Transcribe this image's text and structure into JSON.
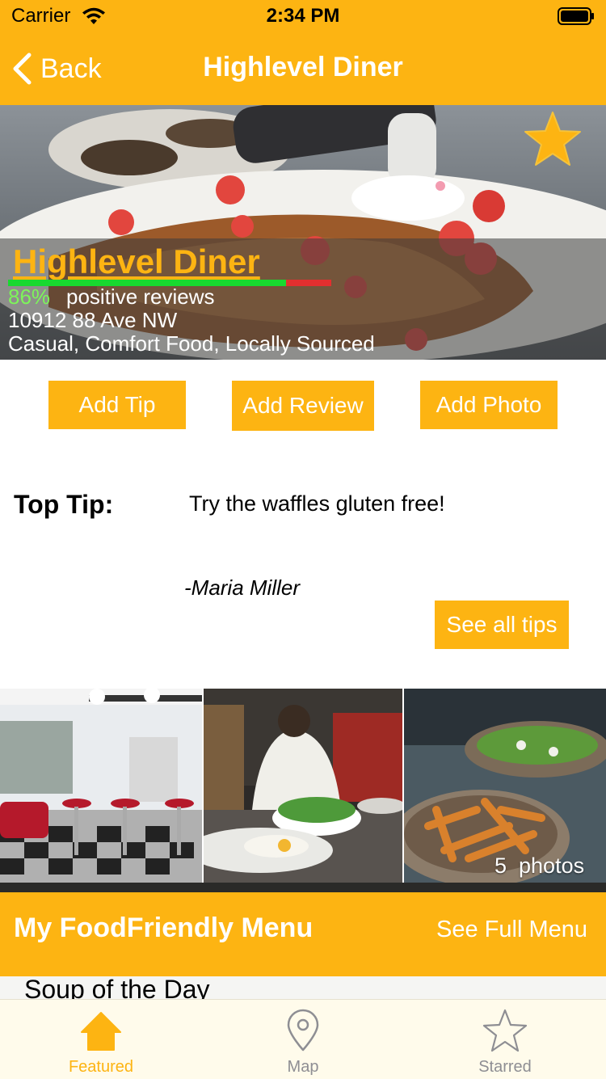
{
  "status_bar": {
    "carrier": "Carrier",
    "time": "2:34 PM"
  },
  "nav": {
    "back_label": "Back",
    "title": "Highlevel Diner"
  },
  "restaurant": {
    "name": "Highlevel Diner",
    "positive_percent_label": "86%",
    "positive_fraction": 0.86,
    "positive_text": "positive reviews",
    "address": "10912 88 Ave NW",
    "tags": "Casual, Comfort Food, Locally Sourced",
    "starred": true
  },
  "actions": {
    "add_tip": "Add Tip",
    "add_review": "Add Review",
    "add_photo": "Add Photo"
  },
  "top_tip": {
    "heading": "Top Tip:",
    "text": "Try the waffles gluten free!",
    "author": "-Maria Miller",
    "see_all": "See all tips"
  },
  "photos": {
    "count_label": "5  photos"
  },
  "menu": {
    "title": "My FoodFriendly Menu",
    "see_full": "See Full Menu",
    "items": [
      "Soup of the Day"
    ]
  },
  "tabs": [
    {
      "label": "Featured",
      "icon": "house-icon",
      "active": true
    },
    {
      "label": "Map",
      "icon": "map-pin-icon",
      "active": false
    },
    {
      "label": "Starred",
      "icon": "star-outline-icon",
      "active": false
    }
  ],
  "colors": {
    "accent": "#FDB412",
    "positive": "#18D92F",
    "negative": "#E32F2F",
    "tab_inactive": "#8E8E93"
  }
}
